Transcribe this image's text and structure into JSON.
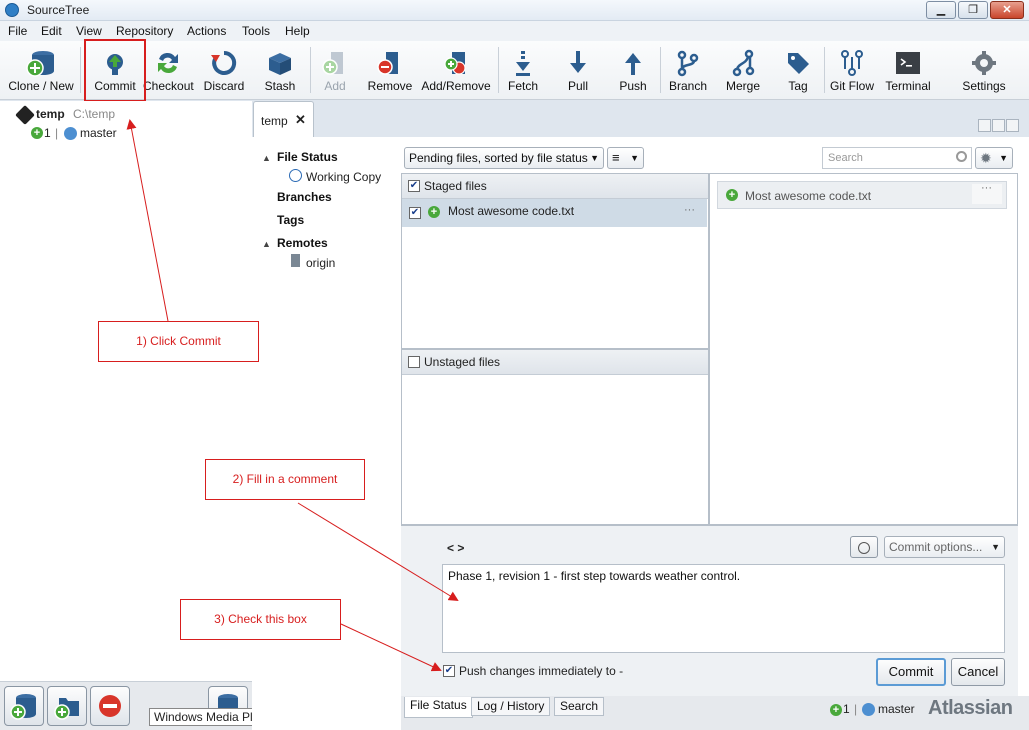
{
  "window": {
    "title": "SourceTree",
    "minimize": "▁",
    "maximize": "❐",
    "close": "✕"
  },
  "menus": [
    "File",
    "Edit",
    "View",
    "Repository",
    "Actions",
    "Tools",
    "Help"
  ],
  "toolbar": {
    "clone_new": "Clone / New",
    "commit": "Commit",
    "checkout": "Checkout",
    "discard": "Discard",
    "stash": "Stash",
    "add": "Add",
    "remove": "Remove",
    "add_remove": "Add/Remove",
    "fetch": "Fetch",
    "pull": "Pull",
    "push": "Push",
    "branch": "Branch",
    "merge": "Merge",
    "tag": "Tag",
    "git_flow": "Git Flow",
    "terminal": "Terminal",
    "settings": "Settings"
  },
  "left": {
    "repo_name": "temp",
    "repo_path": "C:\\temp",
    "ahead_count": "1",
    "sep": "|",
    "branch": "master"
  },
  "tooltip": "Windows Media Player",
  "tab": {
    "label": "temp",
    "close": "✕"
  },
  "sidebar": {
    "file_status": "File Status",
    "working_copy": "Working Copy",
    "branches": "Branches",
    "tags": "Tags",
    "remotes": "Remotes",
    "origin": "origin"
  },
  "filter": {
    "mode": "Pending files, sorted by file status",
    "search_placeholder": "Search"
  },
  "staged": {
    "header": "Staged files",
    "files": [
      "Most awesome code.txt"
    ]
  },
  "unstaged": {
    "header": "Unstaged files"
  },
  "diff": {
    "file": "Most awesome code.txt"
  },
  "commit": {
    "author_placeholder": "< >",
    "options": "Commit options...",
    "message": "Phase 1, revision 1 - first step towards weather control.",
    "push_label": "Push changes immediately to -",
    "push_checked": true,
    "commit_button": "Commit",
    "cancel_button": "Cancel"
  },
  "bottom_tabs": [
    "File Status",
    "Log / History",
    "Search"
  ],
  "status": {
    "ahead_count": "1",
    "sep": "|",
    "branch": "master",
    "brand": "Atlassian"
  },
  "annotations": {
    "step1": "1) Click Commit",
    "step2": "2) Fill in a comment",
    "step3": "3) Check this box"
  },
  "colors": {
    "accent_red": "#d71e1e",
    "add_green": "#49a83b",
    "remove_red": "#d8352a",
    "toolbar_blue": "#2c5d8f"
  }
}
